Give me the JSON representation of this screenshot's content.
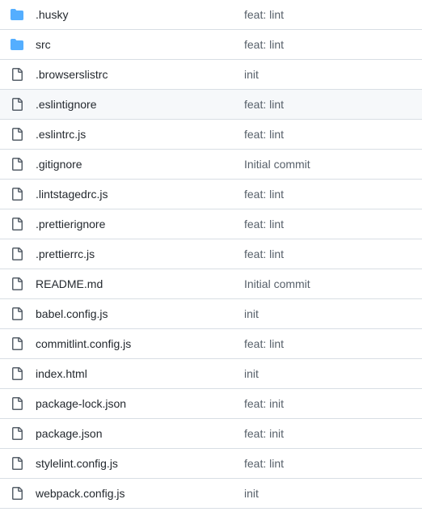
{
  "colors": {
    "folder_icon": "#54aeff",
    "file_icon": "#57606a",
    "name_text": "#24292f",
    "commit_text": "#57606a",
    "row_border": "#d8dee4",
    "row_hover_bg": "#f6f8fa"
  },
  "files": [
    {
      "name": ".husky",
      "type": "folder",
      "icon": "folder-icon",
      "commit": "feat: lint",
      "hovered": false
    },
    {
      "name": "src",
      "type": "folder",
      "icon": "folder-icon",
      "commit": "feat: lint",
      "hovered": false
    },
    {
      "name": ".browserslistrc",
      "type": "file",
      "icon": "file-icon",
      "commit": "init",
      "hovered": false
    },
    {
      "name": ".eslintignore",
      "type": "file",
      "icon": "file-icon",
      "commit": "feat: lint",
      "hovered": true
    },
    {
      "name": ".eslintrc.js",
      "type": "file",
      "icon": "file-icon",
      "commit": "feat: lint",
      "hovered": false
    },
    {
      "name": ".gitignore",
      "type": "file",
      "icon": "file-icon",
      "commit": "Initial commit",
      "hovered": false
    },
    {
      "name": ".lintstagedrc.js",
      "type": "file",
      "icon": "file-icon",
      "commit": "feat: lint",
      "hovered": false
    },
    {
      "name": ".prettierignore",
      "type": "file",
      "icon": "file-icon",
      "commit": "feat: lint",
      "hovered": false
    },
    {
      "name": ".prettierrc.js",
      "type": "file",
      "icon": "file-icon",
      "commit": "feat: lint",
      "hovered": false
    },
    {
      "name": "README.md",
      "type": "file",
      "icon": "file-icon",
      "commit": "Initial commit",
      "hovered": false
    },
    {
      "name": "babel.config.js",
      "type": "file",
      "icon": "file-icon",
      "commit": "init",
      "hovered": false
    },
    {
      "name": "commitlint.config.js",
      "type": "file",
      "icon": "file-icon",
      "commit": "feat: lint",
      "hovered": false
    },
    {
      "name": "index.html",
      "type": "file",
      "icon": "file-icon",
      "commit": "init",
      "hovered": false
    },
    {
      "name": "package-lock.json",
      "type": "file",
      "icon": "file-icon",
      "commit": "feat: init",
      "hovered": false
    },
    {
      "name": "package.json",
      "type": "file",
      "icon": "file-icon",
      "commit": "feat: init",
      "hovered": false
    },
    {
      "name": "stylelint.config.js",
      "type": "file",
      "icon": "file-icon",
      "commit": "feat: lint",
      "hovered": false
    },
    {
      "name": "webpack.config.js",
      "type": "file",
      "icon": "file-icon",
      "commit": "init",
      "hovered": false
    }
  ]
}
